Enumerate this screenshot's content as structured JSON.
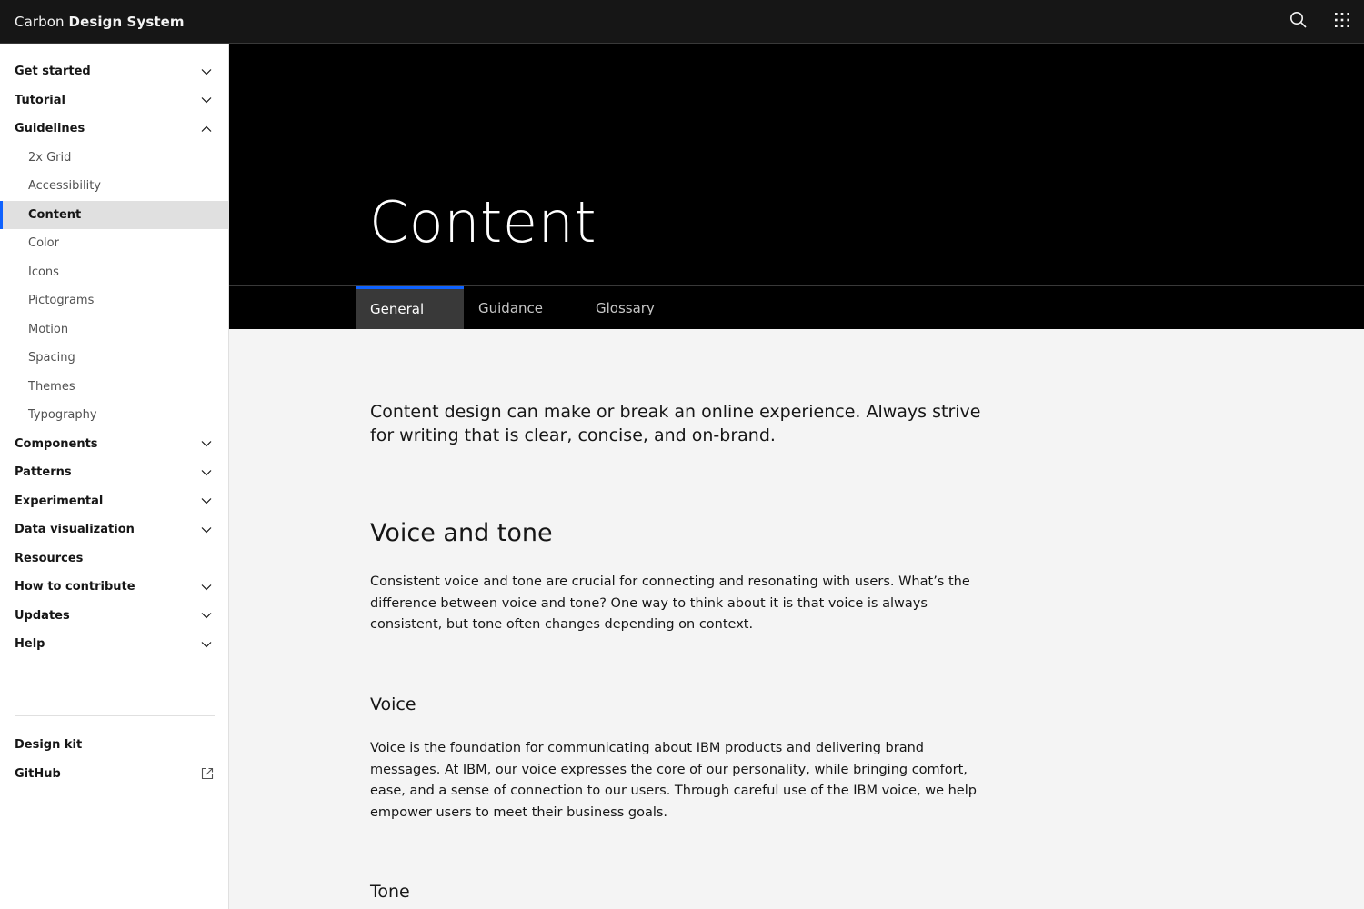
{
  "header": {
    "brand_prefix": "Carbon",
    "brand_name": "Design System"
  },
  "sidebar": {
    "items": [
      {
        "label": "Get started",
        "expanded": false
      },
      {
        "label": "Tutorial",
        "expanded": false
      },
      {
        "label": "Guidelines",
        "expanded": true
      }
    ],
    "guidelines_children": [
      "2x Grid",
      "Accessibility",
      "Content",
      "Color",
      "Icons",
      "Pictograms",
      "Motion",
      "Spacing",
      "Themes",
      "Typography"
    ],
    "active_child": "Content",
    "items_after": [
      {
        "label": "Components",
        "chevron": true
      },
      {
        "label": "Patterns",
        "chevron": true
      },
      {
        "label": "Experimental",
        "chevron": true
      },
      {
        "label": "Data visualization",
        "chevron": true
      },
      {
        "label": "Resources",
        "chevron": false
      },
      {
        "label": "How to contribute",
        "chevron": true
      },
      {
        "label": "Updates",
        "chevron": true
      },
      {
        "label": "Help",
        "chevron": true
      }
    ],
    "footer": [
      {
        "label": "Design kit",
        "external": false
      },
      {
        "label": "GitHub",
        "external": true
      }
    ]
  },
  "hero": {
    "title": "Content"
  },
  "tabs": [
    "General",
    "Guidance",
    "Glossary"
  ],
  "selected_tab": "General",
  "main": {
    "lead": "Content design can make or break an online experience. Always strive for writing that is clear, concise, and on-brand.",
    "section_title": "Voice and tone",
    "section_body": "Consistent voice and tone are crucial for connecting and resonating with users. What’s the difference between voice and tone? One way to think about it is that voice is always consistent, but tone often changes depending on context.",
    "voice_title": "Voice",
    "voice_body": "Voice is the foundation for communicating about IBM products and delivering brand messages. At IBM, our voice expresses the core of our personality, while bringing comfort, ease, and a sense of connection to our users. Through careful use of the IBM voice, we help empower users to meet their business goals.",
    "tone_title": "Tone"
  },
  "colors": {
    "header_bg": "#161616",
    "hero_bg": "#000000",
    "accent": "#0f62fe",
    "content_bg": "#f4f4f4",
    "sidebar_active_bg": "#e0e0e0"
  }
}
